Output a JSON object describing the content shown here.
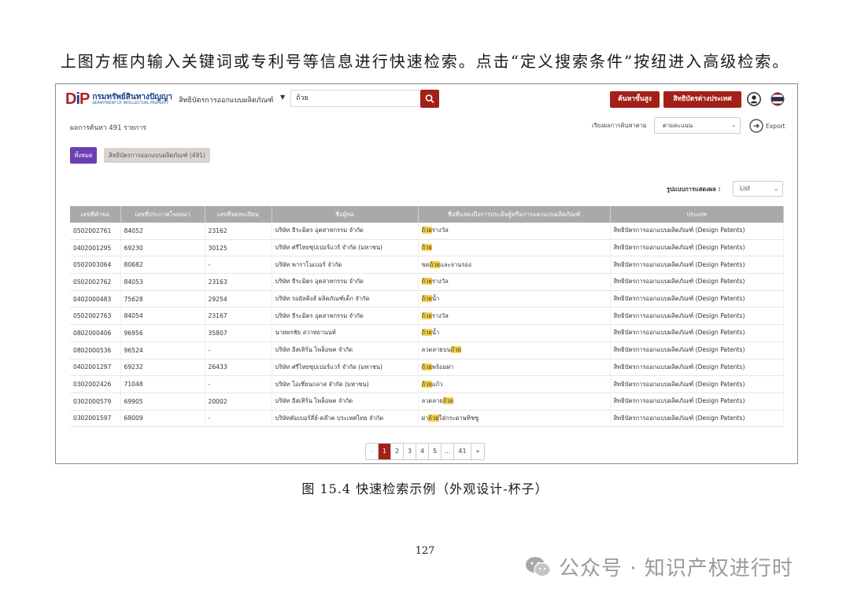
{
  "document": {
    "intro": "上图方框内输入关键词或专利号等信息进行快速检索。点击“定义搜索条件”按纽进入高级检索。",
    "caption": "图 15.4  快速检索示例（外观设计-杯子）",
    "page_number": "127",
    "watermark": "公众号 · 知识产权进行时"
  },
  "app": {
    "logo_text_dip": "DIP",
    "logo_text_th": "กรมทรัพย์สินทางปัญญา",
    "logo_text_en": "DEPARTMENT OF INTELLECTUAL PROPERTY",
    "search_scope": "สิทธิบัตรการออกแบบผลิตภัณฑ์",
    "search_value": "ถ้วย",
    "advanced_button": "ค้นหาขั้นสูง",
    "foreign_button": "สิทธิบัตรต่างประเทศ",
    "result_count": "ผลการค้นหา  491  รายการ",
    "sort_label": "เรียงผลการค้นหาตาม",
    "sort_value": "ตามคะแนน",
    "export_label": "Export",
    "tab_all": "ทั้งหมด",
    "tab_design": "สิทธิบัตรการออกแบบผลิตภัณฑ์ (491)",
    "display_label": "รูปแบบการแสดงผล :",
    "display_value": "List",
    "accent_color": "#a32018",
    "tab_color": "#6c3fb1",
    "highlight_color": "#f7d34a"
  },
  "table": {
    "columns": [
      "เลขที่คำขอ",
      "เลขที่ประกาศโฆษณา",
      "เลขที่จดทะเบียน",
      "ชื่อผู้ขอ",
      "ชื่อที่แสดงถึงการประดิษฐ์หรือการออกแบบผลิตภัณฑ์",
      "ประเภท"
    ],
    "rows": [
      {
        "app_no": "0502002761",
        "pub_no": "84052",
        "reg_no": "23162",
        "applicant": "บริษัท ธีระมิตร อุตสาหกรรม จำกัด",
        "title_pre": "",
        "title_hl": "ถ้วย",
        "title_post": "รางวัล",
        "type": "สิทธิบัตรการออกแบบผลิตภัณฑ์ (Design Patents)"
      },
      {
        "app_no": "0402001295",
        "pub_no": "69230",
        "reg_no": "30125",
        "applicant": "บริษัท ศรีไทยซุปเปอร์แวร์ จำกัด (มหาชน)",
        "title_pre": "",
        "title_hl": "ถ้วย",
        "title_post": "",
        "type": "สิทธิบัตรการออกแบบผลิตภัณฑ์ (Design Patents)"
      },
      {
        "app_no": "0502003064",
        "pub_no": "80682",
        "reg_no": "-",
        "applicant": "บริษัท พาราโนเบอร์ จำกัด",
        "title_pre": "ขด",
        "title_hl": "ถ้วย",
        "title_post": "และจานรอง",
        "type": "สิทธิบัตรการออกแบบผลิตภัณฑ์ (Design Patents)"
      },
      {
        "app_no": "0502002762",
        "pub_no": "84053",
        "reg_no": "23163",
        "applicant": "บริษัท ธีระมิตร อุตสาหกรรม จำกัด",
        "title_pre": "",
        "title_hl": "ถ้วย",
        "title_post": "รางวัล",
        "type": "สิทธิบัตรการออกแบบผลิตภัณฑ์ (Design Patents)"
      },
      {
        "app_no": "0402000483",
        "pub_no": "75628",
        "reg_no": "29254",
        "applicant": "บริษัท รอยัลคิงส์ ผลิตภัณฑ์เด็ก จำกัด",
        "title_pre": "",
        "title_hl": "ถ้วย",
        "title_post": "น้ำ",
        "type": "สิทธิบัตรการออกแบบผลิตภัณฑ์ (Design Patents)"
      },
      {
        "app_no": "0502002763",
        "pub_no": "84054",
        "reg_no": "23167",
        "applicant": "บริษัท ธีระมิตร อุตสาหกรรม จำกัด",
        "title_pre": "",
        "title_hl": "ถ้วย",
        "title_post": "รางวัล",
        "type": "สิทธิบัตรการออกแบบผลิตภัณฑ์ (Design Patents)"
      },
      {
        "app_no": "0802000406",
        "pub_no": "96956",
        "reg_no": "35807",
        "applicant": "นายพรชัย สวาทยานนท์",
        "title_pre": "",
        "title_hl": "ถ้วย",
        "title_post": "น้ำ",
        "type": "สิทธิบัตรการออกแบบผลิตภัณฑ์ (Design Patents)"
      },
      {
        "app_no": "0802000536",
        "pub_no": "96524",
        "reg_no": "-",
        "applicant": "บริษัท อีสเทิร์น ไพล็อพค จำกัด",
        "title_pre": "ลวดลายบน",
        "title_hl": "ถ้วย",
        "title_post": "",
        "type": "สิทธิบัตรการออกแบบผลิตภัณฑ์ (Design Patents)"
      },
      {
        "app_no": "0402001297",
        "pub_no": "69232",
        "reg_no": "26433",
        "applicant": "บริษัท ศรีไทยซุปเปอร์แวร์ จำกัด (มหาชน)",
        "title_pre": "",
        "title_hl": "ถ้วย",
        "title_post": "พร้อมฝา",
        "type": "สิทธิบัตรการออกแบบผลิตภัณฑ์ (Design Patents)"
      },
      {
        "app_no": "0302002426",
        "pub_no": "71048",
        "reg_no": "-",
        "applicant": "บริษัท โอเชี่ยนกลาส จำกัด (มหาชน)",
        "title_pre": "",
        "title_hl": "ถ้วย",
        "title_post": "แก้ว",
        "type": "สิทธิบัตรการออกแบบผลิตภัณฑ์ (Design Patents)"
      },
      {
        "app_no": "0302000579",
        "pub_no": "69905",
        "reg_no": "20002",
        "applicant": "บริษัท อีสเทิร์น ไพล็อพค จำกัด",
        "title_pre": "ลวดลาย",
        "title_hl": "ถ้วย",
        "title_post": "",
        "type": "สิทธิบัตรการออกแบบผลิตภัณฑ์ (Design Patents)"
      },
      {
        "app_no": "0302001597",
        "pub_no": "68009",
        "reg_no": "-",
        "applicant": "บริษัทคัมเบอร์ลี่ย์-คล๊าค ประเทศไทย จำกัด",
        "title_pre": "ฝา",
        "title_hl": "ถ้วย",
        "title_post": "ใส่กระดาษทิชชู",
        "type": "สิทธิบัตรการออกแบบผลิตภัณฑ์ (Design Patents)"
      }
    ]
  },
  "pagination": {
    "prev": "‹",
    "pages": [
      "1",
      "2",
      "3",
      "4",
      "5",
      "...",
      "41"
    ],
    "current": "1",
    "next": "»"
  }
}
